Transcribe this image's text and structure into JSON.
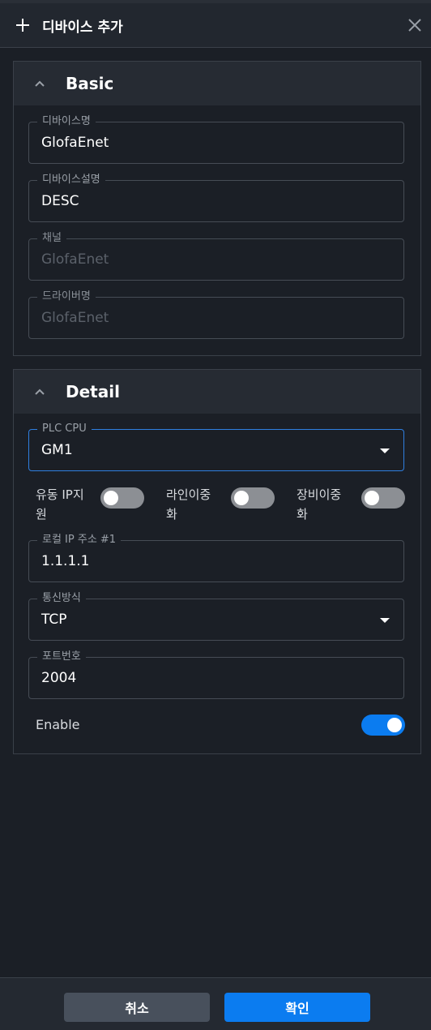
{
  "header": {
    "title": "디바이스 추가",
    "plus_icon": "plus-icon",
    "close_icon": "close-icon"
  },
  "basic": {
    "title": "Basic",
    "fields": {
      "device_name": {
        "label": "디바이스명",
        "value": "GlofaEnet"
      },
      "device_desc": {
        "label": "디바이스설명",
        "value": "DESC"
      },
      "channel": {
        "label": "채널",
        "value": "GlofaEnet"
      },
      "driver_name": {
        "label": "드라이버명",
        "value": "GlofaEnet"
      }
    }
  },
  "detail": {
    "title": "Detail",
    "plc_cpu": {
      "label": "PLC CPU",
      "value": "GM1"
    },
    "toggles": {
      "floating_ip": {
        "label": "유동 IP지원",
        "on": false
      },
      "line_redundancy": {
        "label": "라인이중화",
        "on": false
      },
      "device_redundancy": {
        "label": "장비이중화",
        "on": false
      }
    },
    "local_ip": {
      "label": "로컬 IP 주소 #1",
      "value": "1.1.1.1"
    },
    "protocol": {
      "label": "통신방식",
      "value": "TCP"
    },
    "port": {
      "label": "포트번호",
      "value": "2004"
    },
    "enable": {
      "label": "Enable",
      "on": true
    }
  },
  "footer": {
    "cancel_label": "취소",
    "ok_label": "확인"
  },
  "colors": {
    "accent": "#0b7cf0",
    "background": "#1b1f26",
    "toggle_off": "#8c8f94"
  }
}
